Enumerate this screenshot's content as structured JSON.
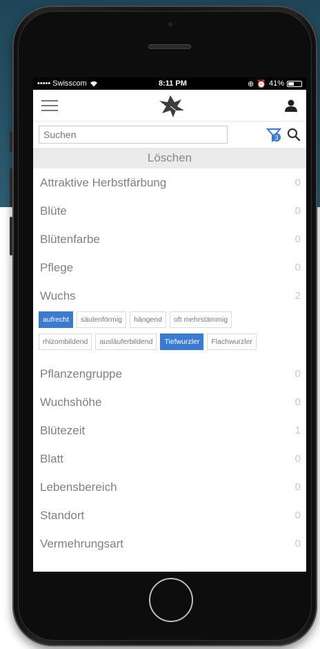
{
  "status_bar": {
    "carrier": "••••• Swisscom",
    "time": "8:11 PM",
    "battery": "41%"
  },
  "header": {
    "menu_icon": "hamburger-icon",
    "logo_icon": "leaf-logo",
    "user_icon": "user-icon"
  },
  "search": {
    "placeholder": "Suchen",
    "filter_badge": "3"
  },
  "clear_label": "Löschen",
  "categories_top": [
    {
      "label": "Attraktive Herbstfärbung",
      "count": "0"
    },
    {
      "label": "Blüte",
      "count": "0"
    },
    {
      "label": "Blütenfarbe",
      "count": "0"
    },
    {
      "label": "Pflege",
      "count": "0"
    },
    {
      "label": "Wuchs",
      "count": "2"
    }
  ],
  "wuchs_options_row1": [
    {
      "label": "aufrecht",
      "active": true
    },
    {
      "label": "säulenförmig",
      "active": false
    },
    {
      "label": "hängend",
      "active": false
    },
    {
      "label": "oft mehrstämmig",
      "active": false
    }
  ],
  "wuchs_options_row2": [
    {
      "label": "rhizombildend",
      "active": false
    },
    {
      "label": "ausläuferbildend",
      "active": false
    },
    {
      "label": "Tiefwurzler",
      "active": true
    },
    {
      "label": "Flachwurzler",
      "active": false
    }
  ],
  "categories_bottom": [
    {
      "label": "Pflanzengruppe",
      "count": "0"
    },
    {
      "label": "Wuchshöhe",
      "count": "0"
    },
    {
      "label": "Blütezeit",
      "count": "1"
    },
    {
      "label": "Blatt",
      "count": "0"
    },
    {
      "label": "Lebensbereich",
      "count": "0"
    },
    {
      "label": "Standort",
      "count": "0"
    },
    {
      "label": "Vermehrungsart",
      "count": "0"
    }
  ],
  "colors": {
    "accent": "#3a7ad0",
    "text": "#808080",
    "background_top": "#24485a"
  }
}
